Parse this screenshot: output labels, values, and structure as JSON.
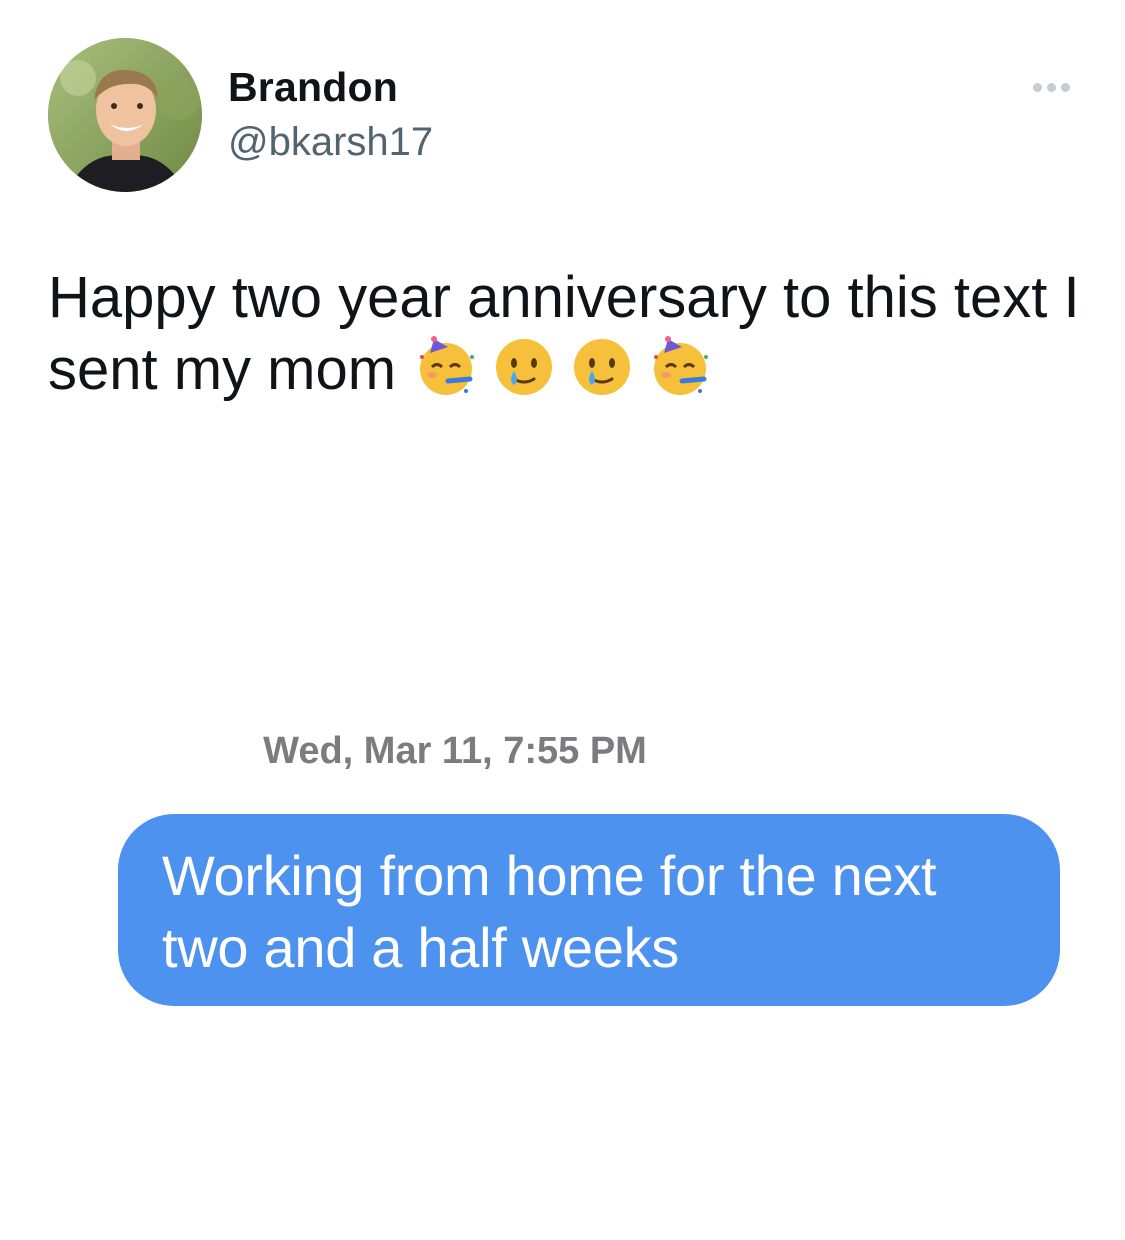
{
  "author": {
    "name": "Brandon",
    "handle": "@bkarsh17",
    "avatar_icon": "profile-photo-avatar"
  },
  "menu": {
    "icon": "more-horizontal-icon"
  },
  "tweet": {
    "text": "Happy two year anniversary to this text I sent my mom",
    "emojis": [
      {
        "name": "partying-face",
        "char": "🥳"
      },
      {
        "name": "smiling-face-with-tear",
        "char": "🥲"
      },
      {
        "name": "smiling-face-with-tear",
        "char": "🥲"
      },
      {
        "name": "partying-face",
        "char": "🥳"
      }
    ]
  },
  "attached_image": {
    "timestamp": "Wed, Mar 11, 7:55 PM",
    "message": "Working from home for the next two and a half weeks",
    "bubble_color": "#4d92ee"
  },
  "colors": {
    "text_primary": "#0f1419",
    "text_secondary": "#536471",
    "background": "#ffffff"
  }
}
